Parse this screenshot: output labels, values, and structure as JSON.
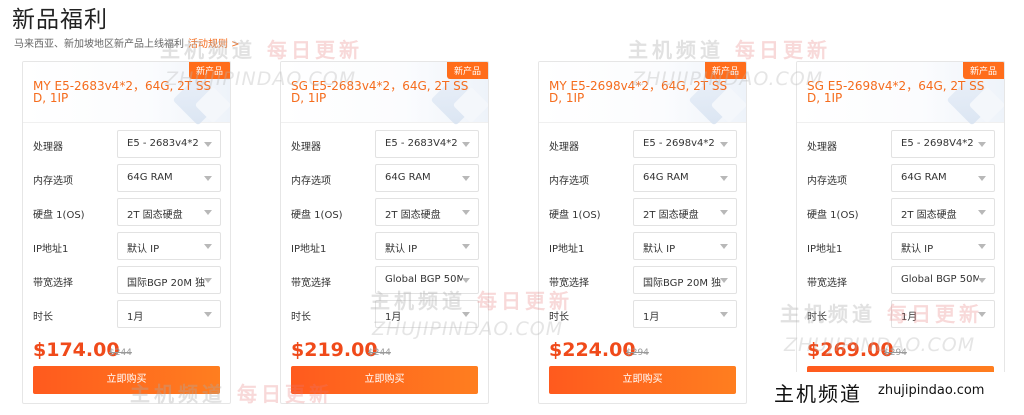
{
  "page": {
    "title": "新品福利",
    "subtitle": "马来西亚、新加坡地区新产品上线福利",
    "rules_link": "活动规则 >"
  },
  "labels": {
    "cpu": "处理器",
    "ram": "内存选项",
    "disk": "硬盘 1(OS)",
    "ip": "IP地址1",
    "bandwidth": "带宽选择",
    "duration": "时长"
  },
  "cards": [
    {
      "badge": "新产品",
      "title": "MY E5-2683v4*2，64G, 2T SSD, 1IP",
      "cpu": "E5 - 2683v4*2",
      "ram": "64G RAM",
      "disk": "2T 固态硬盘",
      "ip": "默认 IP",
      "bandwidth": "国际BGP 20M 独",
      "duration": "1月",
      "price": "$174.00",
      "old_price": "$244",
      "buy": "立即购买"
    },
    {
      "badge": "新产品",
      "title": "SG E5-2683v4*2，64G, 2T SSD, 1IP",
      "cpu": "E5 - 2683V4*2",
      "ram": "64G RAM",
      "disk": "2T 固态硬盘",
      "ip": "默认 IP",
      "bandwidth": "Global BGP 50M",
      "duration": "1月",
      "price": "$219.00",
      "old_price": "$244",
      "buy": "立即购买"
    },
    {
      "badge": "新产品",
      "title": "MY E5-2698v4*2，64G, 2T SSD, 1IP",
      "cpu": "E5 - 2698v4*2",
      "ram": "64G RAM",
      "disk": "2T 固态硬盘",
      "ip": "默认 IP",
      "bandwidth": "国际BGP 20M 独",
      "duration": "1月",
      "price": "$224.00",
      "old_price": "$294",
      "buy": "立即购买"
    },
    {
      "badge": "新产品",
      "title": "SG E5-2698v4*2，64G, 2T SSD, 1IP",
      "cpu": "E5 - 2698V4*2",
      "ram": "64G RAM",
      "disk": "2T 固态硬盘",
      "ip": "默认 IP",
      "bandwidth": "Global BGP 50M",
      "duration": "1月",
      "price": "$269.00",
      "old_price": "$294",
      "buy": "立即购买"
    }
  ],
  "watermark": {
    "zh_gray": "主机频道",
    "zh_red": "每日更新",
    "en": "ZHUJIPINDAO.COM"
  },
  "brand": {
    "zh": "主机频道",
    "en": "zhujipindao.com"
  },
  "colors": {
    "accent": "#f56c1d",
    "price": "#f04a1a",
    "button": "#ff6d1b"
  }
}
